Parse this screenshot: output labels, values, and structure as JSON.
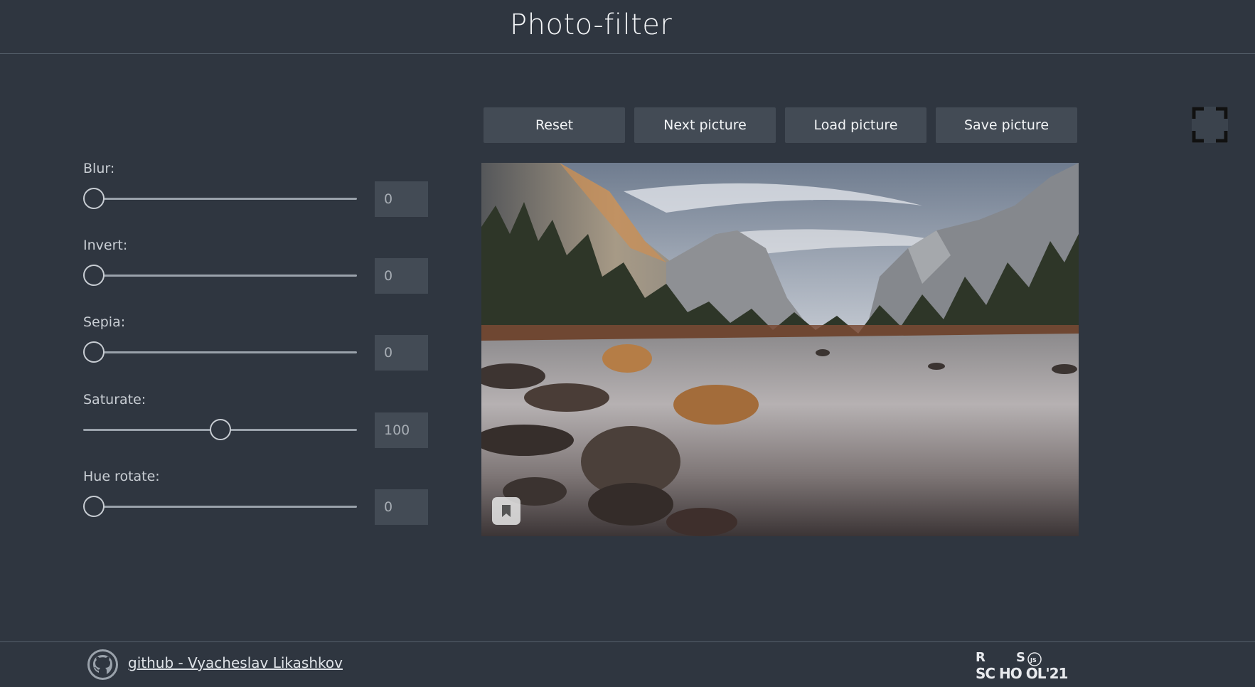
{
  "header": {
    "title": "Photo-filter"
  },
  "toolbar": {
    "reset_label": "Reset",
    "next_label": "Next picture",
    "load_label": "Load picture",
    "save_label": "Save picture"
  },
  "fullscreen": {
    "icon": "fullscreen-icon"
  },
  "filters": [
    {
      "label": "Blur:",
      "value": "0",
      "fraction": 0.0
    },
    {
      "label": "Invert:",
      "value": "0",
      "fraction": 0.0
    },
    {
      "label": "Sepia:",
      "value": "0",
      "fraction": 0.0
    },
    {
      "label": "Saturate:",
      "value": "100",
      "fraction": 0.5
    },
    {
      "label": "Hue rotate:",
      "value": "0",
      "fraction": 0.0
    }
  ],
  "photo": {
    "bookmark_icon": "bookmark-icon"
  },
  "footer": {
    "github_link": "github - Vyacheslav Likashkov",
    "logo_text": {
      "line1_r": "R",
      "line1_s": "S",
      "line1_js": "JS",
      "line2": "SC HO OL'21"
    }
  },
  "colors": {
    "background": "#2f3640",
    "button_bg": "#434b55",
    "text": "#f2f4f6"
  }
}
